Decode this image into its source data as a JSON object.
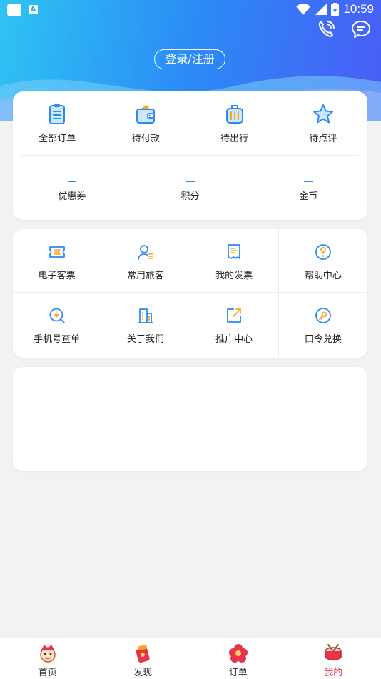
{
  "status_bar": {
    "time": "10:59",
    "notification_badge": "A"
  },
  "header": {
    "login_label": "登录/注册"
  },
  "orders": {
    "items": [
      {
        "label": "全部订单",
        "icon": "clipboard-icon"
      },
      {
        "label": "待付款",
        "icon": "wallet-icon"
      },
      {
        "label": "待出行",
        "icon": "suitcase-icon"
      },
      {
        "label": "待点评",
        "icon": "star-icon"
      }
    ],
    "stats": [
      {
        "label": "优惠券",
        "value": "--"
      },
      {
        "label": "积分",
        "value": "--"
      },
      {
        "label": "金币",
        "value": "--"
      }
    ]
  },
  "services": {
    "items": [
      {
        "label": "电子客票",
        "icon": "ticket-icon"
      },
      {
        "label": "常用旅客",
        "icon": "traveler-icon"
      },
      {
        "label": "我的发票",
        "icon": "invoice-icon"
      },
      {
        "label": "帮助中心",
        "icon": "help-icon"
      },
      {
        "label": "手机号查单",
        "icon": "phone-search-icon"
      },
      {
        "label": "关于我们",
        "icon": "building-icon"
      },
      {
        "label": "推广中心",
        "icon": "share-icon"
      },
      {
        "label": "口令兑换",
        "icon": "key-icon"
      }
    ]
  },
  "tabbar": {
    "items": [
      {
        "label": "首页",
        "icon": "home-mascot-icon"
      },
      {
        "label": "发现",
        "icon": "discover-icon"
      },
      {
        "label": "订单",
        "icon": "order-flower-icon"
      },
      {
        "label": "我的",
        "icon": "mine-drum-icon"
      }
    ],
    "active": "我的"
  },
  "colors": {
    "accent": "#2b8bf5",
    "active_tab": "#e8334a",
    "icon_orange": "#f5a623"
  }
}
